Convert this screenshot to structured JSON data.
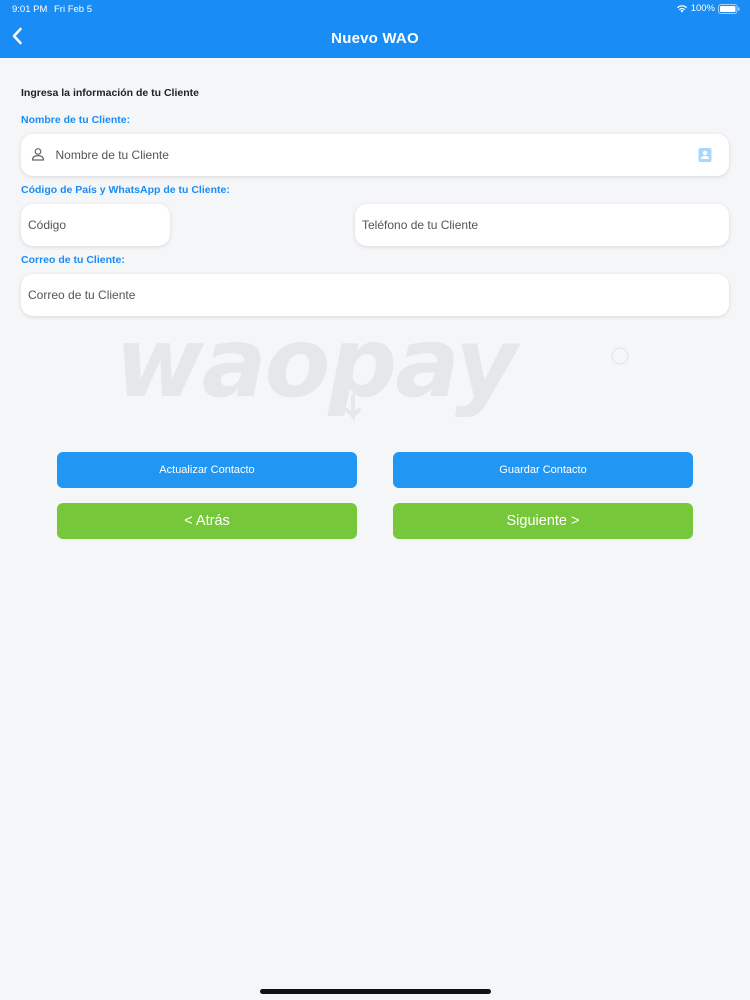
{
  "status_bar": {
    "time": "9:01 PM",
    "date": "Fri Feb 5",
    "battery": "100%",
    "wifi_icon": "wifi-icon",
    "battery_icon": "battery-icon"
  },
  "header": {
    "title": "Nuevo WAO",
    "back_icon": "chevron-left-icon",
    "background_color": "#1a8cf5"
  },
  "form": {
    "instructions": "Ingresa la información de tu Cliente",
    "name": {
      "label": "Nombre de tu Cliente:",
      "placeholder": "Nombre de tu Cliente",
      "value": "",
      "leading_icon": "person-icon",
      "trailing_icon": "contacts-book-icon"
    },
    "phone": {
      "label": "Código de País y WhatsApp de tu Cliente:",
      "code_placeholder": "Código",
      "phone_placeholder": "Teléfono de tu Cliente"
    },
    "email": {
      "label": "Correo de tu Cliente:",
      "placeholder": "Correo de tu Cliente"
    }
  },
  "watermark": {
    "brand": "waopay"
  },
  "buttons": {
    "update_contact": "Actualizar Contacto",
    "save_contact": "Guardar Contacto",
    "back": "< Atrás",
    "next": "Siguiente >",
    "blue_color": "#2196f3",
    "green_color": "#76c73a"
  }
}
